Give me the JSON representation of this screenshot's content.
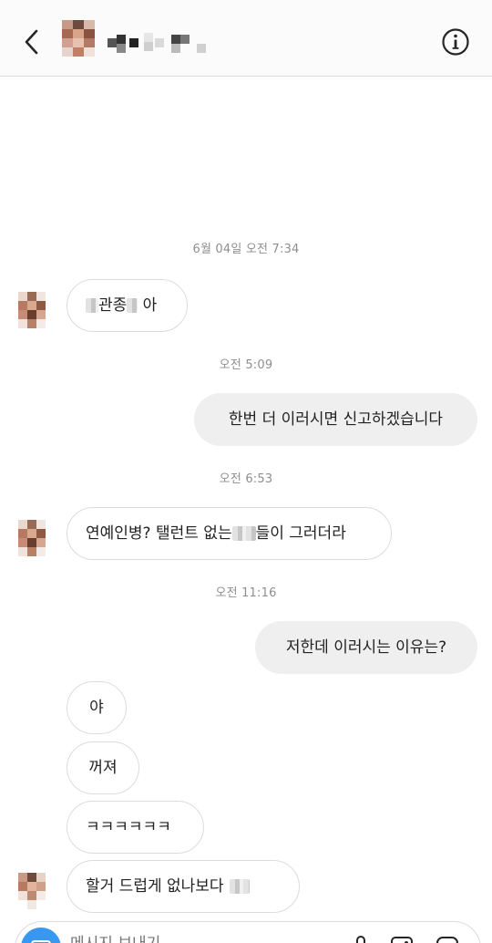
{
  "header": {
    "back_icon": "chevron-left-icon",
    "info_icon": "info-circle-icon"
  },
  "thread": {
    "timestamps": [
      "6월 04일 오전 7:34",
      "오전 5:09",
      "오전 6:53",
      "오전 11:16"
    ],
    "messages": [
      {
        "from": "them",
        "text_a": "",
        "text_b": "관종",
        "text_c": " 아"
      },
      {
        "from": "me",
        "text": "한번 더 이러시면 신고하겠습니다"
      },
      {
        "from": "them",
        "text_a": "연예인병? 탤런트 없는",
        "text_b": "들이 그러더라"
      },
      {
        "from": "me",
        "text": "저한데 이러시는 이유는?"
      },
      {
        "from": "them",
        "text": "야"
      },
      {
        "from": "them",
        "text": "꺼져"
      },
      {
        "from": "them",
        "text": "ㅋㅋㅋㅋㅋㅋ"
      },
      {
        "from": "them",
        "text": "할거 드럽게 없나보다"
      }
    ]
  },
  "composer": {
    "placeholder": "메시지 보내기...",
    "camera_icon": "camera-icon",
    "mic_icon": "microphone-icon",
    "gallery_icon": "gallery-icon",
    "sticker_icon": "sticker-icon"
  }
}
